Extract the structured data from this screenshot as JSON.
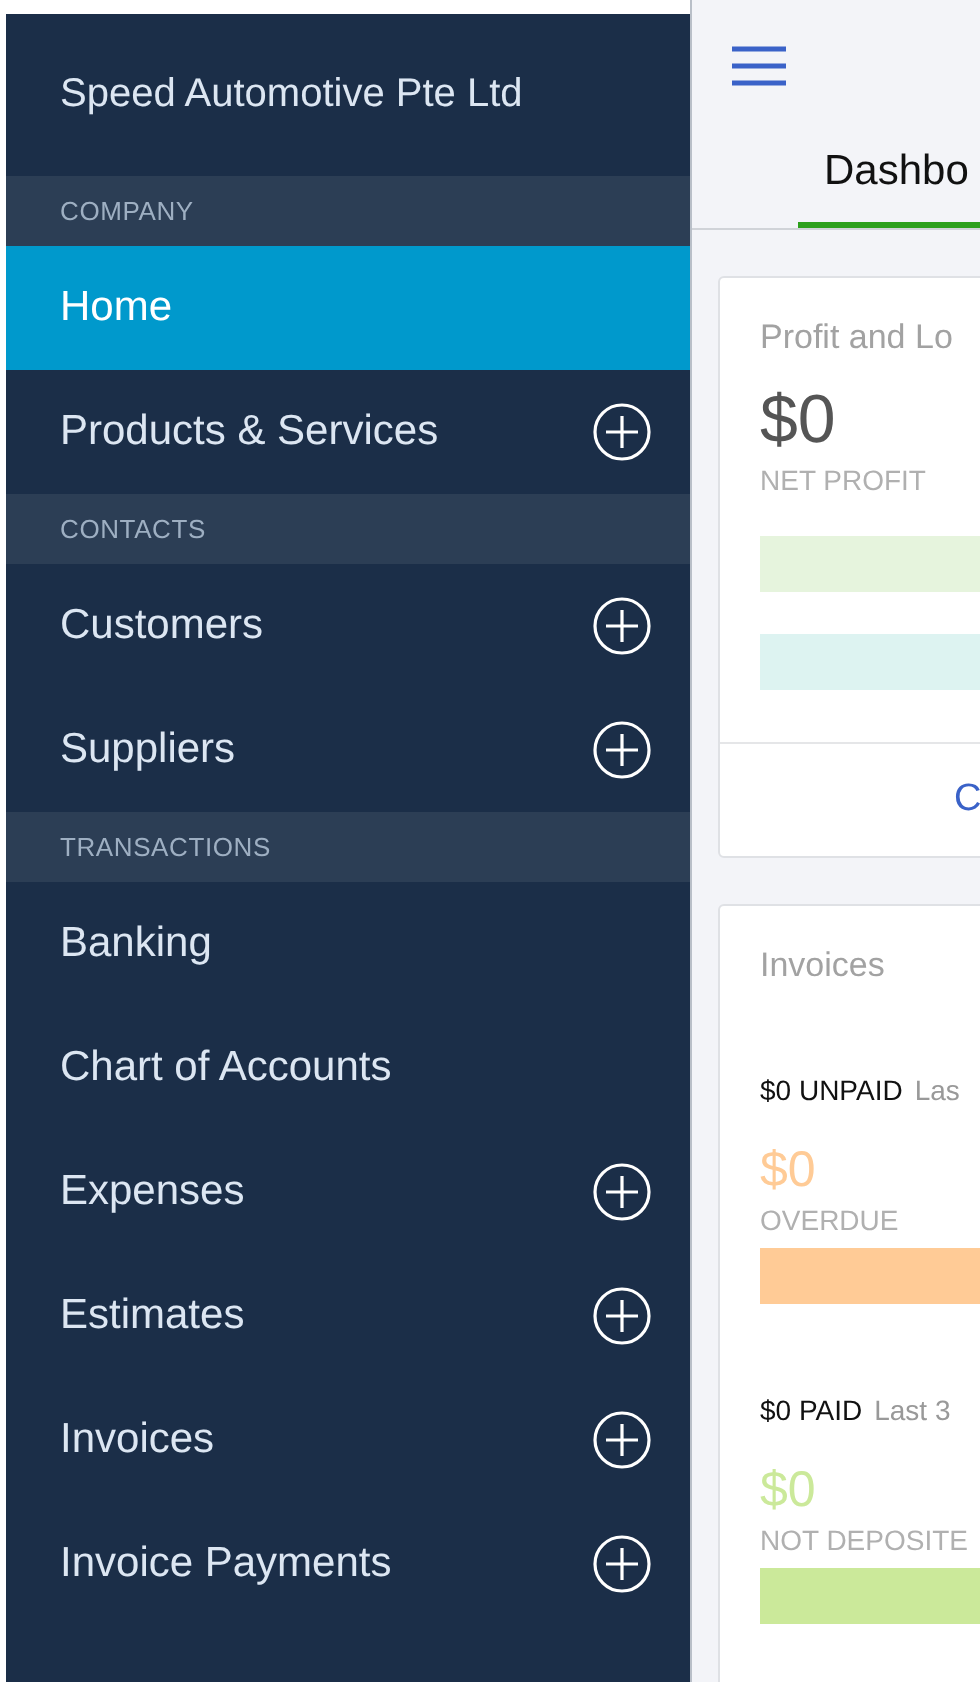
{
  "sidebar": {
    "company": "Speed Automotive Pte Ltd",
    "sections": [
      {
        "header": "COMPANY",
        "items": [
          {
            "label": "Home",
            "selected": true,
            "add_button": false
          },
          {
            "label": "Products & Services",
            "selected": false,
            "add_button": true
          }
        ]
      },
      {
        "header": "CONTACTS",
        "items": [
          {
            "label": "Customers",
            "selected": false,
            "add_button": true
          },
          {
            "label": "Suppliers",
            "selected": false,
            "add_button": true
          }
        ]
      },
      {
        "header": "TRANSACTIONS",
        "items": [
          {
            "label": "Banking",
            "selected": false,
            "add_button": false
          },
          {
            "label": "Chart of Accounts",
            "selected": false,
            "add_button": false
          },
          {
            "label": "Expenses",
            "selected": false,
            "add_button": true
          },
          {
            "label": "Estimates",
            "selected": false,
            "add_button": true
          },
          {
            "label": "Invoices",
            "selected": false,
            "add_button": true
          },
          {
            "label": "Invoice Payments",
            "selected": false,
            "add_button": true
          }
        ]
      }
    ]
  },
  "main": {
    "tabs": [
      {
        "label": "Dashbo",
        "selected": true
      }
    ],
    "profit_card": {
      "title": "Profit and Lo",
      "amount": "$0",
      "caption": "NET PROFIT",
      "link": "C"
    },
    "invoices_card": {
      "title": "Invoices",
      "groups": [
        {
          "amount": "$0 UNPAID",
          "period": "Las",
          "value": "$0",
          "caption": "OVERDUE",
          "color": "#ffcb96"
        },
        {
          "amount": "$0 PAID",
          "period": "Last 3",
          "value": "$0",
          "caption": "NOT DEPOSITE",
          "color": "#cbe99a"
        }
      ]
    }
  }
}
